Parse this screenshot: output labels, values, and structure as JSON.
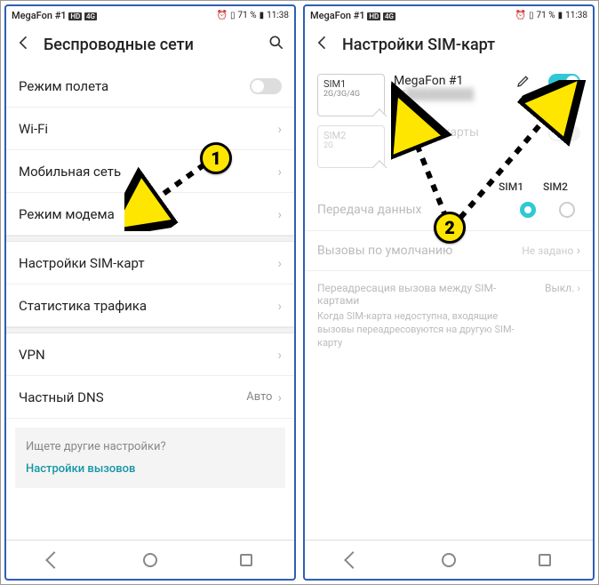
{
  "status": {
    "carrier": "MegaFon #1",
    "alarm_icon": "⏰",
    "battry_pct": "71 %",
    "time": "11:38"
  },
  "left": {
    "title": "Беспроводные сети",
    "airplane": "Режим полета",
    "wifi": "Wi-Fi",
    "mobile": "Мобильная сеть",
    "tether": "Режим модема",
    "sim": "Настройки SIM-карт",
    "traffic": "Статистика трафика",
    "vpn": "VPN",
    "dns": "Частный DNS",
    "dns_val": "Авто",
    "tip_q": "Ищете другие настройки?",
    "tip_link": "Настройки вызовов"
  },
  "right": {
    "title": "Настройки SIM-карт",
    "sim1": {
      "slot": "SIM1",
      "tech": "2G/3G/4G",
      "name": "MegaFon #1",
      "num_prefix": "+7"
    },
    "sim2": {
      "slot": "SIM2",
      "tech": "2G",
      "name": "Нет SIM-карты"
    },
    "col_sim1": "SIM1",
    "col_sim2": "SIM2",
    "data_label": "Передача данных",
    "calls_label": "Вызовы по умолчанию",
    "calls_val": "Не задано",
    "fwd_title": "Переадресация вызова между SIM-картами",
    "fwd_desc": "Когда SIM-карта недоступна, входящие вызовы переадресовуются на другую SIM-карту",
    "fwd_val": "Выкл."
  },
  "annotations": {
    "n1": "1",
    "n2": "2"
  }
}
